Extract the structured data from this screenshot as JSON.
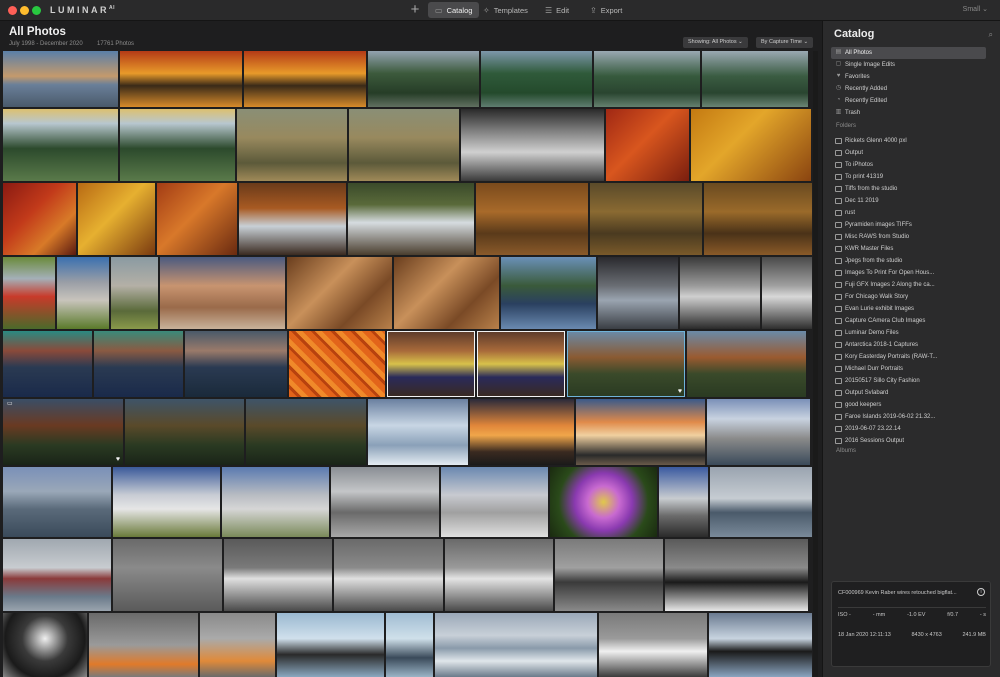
{
  "app": {
    "logo": "LUMINAR",
    "logo_super": "AI",
    "add_label": "+",
    "nav": [
      {
        "label": "Catalog",
        "icon": "folder-icon"
      },
      {
        "label": "Templates",
        "icon": "templates-icon"
      },
      {
        "label": "Edit",
        "icon": "sliders-icon"
      },
      {
        "label": "Export",
        "icon": "export-icon"
      }
    ],
    "size_label": "Small ⌄"
  },
  "main": {
    "title": "All Photos",
    "date_range": "July 1998 - December 2020",
    "photo_count": "17761 Photos",
    "showing_filter": "Showing: All Photos ⌄",
    "sort_label": "By Capture Time ⌄"
  },
  "sidebar": {
    "title": "Catalog",
    "items": [
      {
        "label": "All Photos",
        "icon": "photos-icon",
        "active": true
      },
      {
        "label": "Single Image Edits",
        "icon": "single-image-icon"
      },
      {
        "label": "Favorites",
        "icon": "heart-icon"
      },
      {
        "label": "Recently Added",
        "icon": "clock-icon"
      },
      {
        "label": "Recently Edited",
        "icon": "edited-icon"
      },
      {
        "label": "Trash",
        "icon": "trash-icon"
      }
    ],
    "folders_header": "Folders",
    "folders": [
      "Rickets Glenn 4000 pxl",
      "Output",
      "To iPhotos",
      "To print 41319",
      "Tiffs from the studio",
      "Dec 11 2019",
      "rust",
      "Pyramiden images TIFFs",
      "Misc RAWS from Studio",
      "KWR Master Files",
      "Jpegs from the studio",
      "Images To Print For Open Hous...",
      "Fuji GFX Images 2 Along the ca...",
      "For Chicago Walk Story",
      "Evan Lurie exhibit Images",
      "Capture CAmera Club Images",
      "Luminar Demo Files",
      "Antarctica 2018-1 Captures",
      "Kory Easterday Portraits (RAW-T...",
      "Michael Durr Portraits",
      "20150517 Sillo City Fashion",
      "Output Svlabard",
      "good keepers",
      "Faroe Islands 2019-06-02 21.32...",
      "2019-06-07 23.22.14",
      "2016 Sessions Output"
    ],
    "albums_header": "Albums",
    "info": {
      "filename": "CF000969 Kevin Raber wires retouched bigflat...",
      "info_glyph": "i",
      "iso": "ISO -",
      "focal": "- mm",
      "ev": "-1.0 EV",
      "aperture": "f/0.7",
      "shutter": "- s",
      "date": "18 Jan 2020 12:11:13",
      "dimensions": "8430 x 4763",
      "filesize": "241.9 MB"
    }
  },
  "grid": {
    "rows": [
      {
        "h": 56,
        "thumbs": [
          {
            "w": 115,
            "bg": "linear-gradient(180deg,#5a7fa8 0%,#c49a6c 45%,#6a7f99 60%,#4a5a6b 100%)"
          },
          {
            "w": 122,
            "bg": "linear-gradient(180deg,#b43a16 0%,#e89a2a 40%,#3a2a18 62%,#d88b2a 100%)"
          },
          {
            "w": 122,
            "bg": "linear-gradient(180deg,#b43a16 0%,#e89a2a 40%,#3a2a18 62%,#d88b2a 100%)"
          },
          {
            "w": 111,
            "bg": "linear-gradient(180deg,#93a2b0 0%,#3c5a3c 40%,#263d27 75%,#607060 100%)"
          },
          {
            "w": 111,
            "bg": "linear-gradient(180deg,#7d97ab 0%,#2f5a3a 40%,#244a2c 75%,#5f7d70 100%)"
          },
          {
            "w": 106,
            "bg": "linear-gradient(180deg,#9aa8b2 0%,#365a3d 45%,#2a4530 75%,#64806e 100%)"
          },
          {
            "w": 106,
            "bg": "linear-gradient(180deg,#9aa8b2 0%,#3a5c42 45%,#2a4530 75%,#6a8574 100%)"
          }
        ]
      },
      {
        "h": 72,
        "thumbs": [
          {
            "w": 115,
            "bg": "linear-gradient(180deg,#dcc070 0%,#b8c7cf 20%,#2c4a2c 55%,#5a7a4a 100%)"
          },
          {
            "w": 115,
            "bg": "linear-gradient(180deg,#dcc070 0%,#b8c7cf 20%,#2c4a2c 55%,#5a7a4a 100%)"
          },
          {
            "w": 110,
            "bg": "linear-gradient(180deg,#8a8f76 0%,#98895e 40%,#5c5a3a 75%,#a08a58 100%)"
          },
          {
            "w": 110,
            "bg": "linear-gradient(180deg,#8a8f76 0%,#98895e 40%,#5c5a3a 75%,#a08a58 100%)"
          },
          {
            "w": 143,
            "bg": "linear-gradient(180deg,#2a2a2a 0%,#8c8c8c 35%,#d0d0d0 60%,#3a3a3a 100%)"
          },
          {
            "w": 83,
            "bg": "linear-gradient(135deg,#a02814 0%,#d8561e 45%,#7a1e0e 100%)"
          },
          {
            "w": 120,
            "bg": "linear-gradient(135deg,#c47a12 0%,#e3a62a 40%,#8a4410 100%)"
          }
        ]
      },
      {
        "h": 72,
        "thumbs": [
          {
            "w": 73,
            "bg": "linear-gradient(135deg,#8a1a12 0%,#c23a1a 40%,#d87a28 70%,#5a1a10 100%)"
          },
          {
            "w": 77,
            "bg": "linear-gradient(135deg,#b86a14 0%,#e6b030 45%,#7a3a10 100%)"
          },
          {
            "w": 80,
            "bg": "linear-gradient(135deg,#a33c14 0%,#d8782a 45%,#6a2a10 100%)"
          },
          {
            "w": 107,
            "bg": "linear-gradient(180deg,#6a3a1a 0%,#a85a22 35%,#c8d0d6 60%,#3a2a20 100%)"
          },
          {
            "w": 126,
            "bg": "linear-gradient(180deg,#3a4a2a 0%,#5a6a3a 30%,#d6dce0 55%,#4a3e2e 100%)"
          },
          {
            "w": 112,
            "bg": "linear-gradient(180deg,#7a4a1c 0%,#a86a2a 40%,#5a3a1a 70%,#8a5a2a 100%)"
          },
          {
            "w": 112,
            "bg": "linear-gradient(180deg,#5a4a2a 0%,#8a6a32 40%,#4a3a20 70%,#7a5a2a 100%)"
          },
          {
            "w": 110,
            "bg": "linear-gradient(180deg,#6a4a20 0%,#9a6a2a 40%,#4a3218 70%,#8a5a28 100%)"
          }
        ]
      },
      {
        "h": 72,
        "thumbs": [
          {
            "w": 52,
            "bg": "linear-gradient(180deg,#6a8a3a 0%,#a4b0b8 30%,#c83a2a 55%,#4a6a2a 100%)"
          },
          {
            "w": 52,
            "bg": "linear-gradient(180deg,#3a70b0 0%,#9a9ea6 35%,#c8c4bc 60%,#5a7a2a 100%)"
          },
          {
            "w": 47,
            "bg": "linear-gradient(180deg,#8a9aa2 0%,#b4b0a6 40%,#5a6a3a 75%,#8a9a4a 100%)"
          },
          {
            "w": 125,
            "bg": "linear-gradient(180deg,#4a5a80 0%,#c89470 40%,#9a6a4a 70%,#c8b29a 100%)"
          },
          {
            "w": 105,
            "bg": "linear-gradient(135deg,#6a3e1e 0%,#c8905a 40%,#7a4a26 70%,#b8804a 100%)"
          },
          {
            "w": 105,
            "bg": "linear-gradient(135deg,#6a3e1e 0%,#c8905a 40%,#7a4a26 70%,#b8804a 100%)"
          },
          {
            "w": 95,
            "bg": "linear-gradient(180deg,#6a90b8 0%,#3a5a3a 40%,#2a4060 65%,#6a8ab0 100%)"
          },
          {
            "w": 80,
            "bg": "linear-gradient(180deg,#2a2a2e 0%,#6a6e74 40%,#9aa4b0 60%,#3a3e44 100%)"
          },
          {
            "w": 80,
            "bg": "linear-gradient(180deg,#3a3a3a 0%,#9a9a9a 40%,#cfcfcf 55%,#2a2a2a 100%)"
          },
          {
            "w": 55,
            "bg": "linear-gradient(180deg,#4a4a4a 0%,#a0a0a0 40%,#d8d8d8 55%,#2e2e2e 100%)"
          }
        ]
      },
      {
        "h": 66,
        "thumbs": [
          {
            "w": 89,
            "bg": "linear-gradient(180deg,#2a8a82 0%,#8a4a3a 30%,#2a3a52 55%,#1a2a4a 100%)"
          },
          {
            "w": 89,
            "bg": "linear-gradient(180deg,#3a8a7a 0%,#8a5a42 30%,#2a3a52 55%,#1a2a4a 100%)"
          },
          {
            "w": 102,
            "bg": "linear-gradient(180deg,#4a5a6a 0%,#9a7a6a 30%,#2a3a52 55%,#1a2a3a 100%)"
          },
          {
            "w": 96,
            "bg": "repeating-linear-gradient(45deg,#e2641a 0 6px,#b8420e 6px 9px,#f08a2a 9px 14px)"
          },
          {
            "w": 88,
            "sel": "white",
            "bg": "linear-gradient(180deg,#5a3a2a 0%,#a86a3a 30%,#d8c24a 50%,#2a2a5a 70%,#3a2a20 100%)"
          },
          {
            "w": 88,
            "sel": "white",
            "bg": "linear-gradient(180deg,#5a3a2a 0%,#a86a3a 30%,#d8c24a 50%,#2a2a5a 70%,#3a2a20 100%)"
          },
          {
            "w": 118,
            "sel": "blue",
            "heart": true,
            "bg": "linear-gradient(180deg,#6a8aa8 0%,#8a5a32 40%,#3a4a2a 65%,#2a3a22 100%)"
          },
          {
            "w": 119,
            "bg": "linear-gradient(180deg,#6a8aa8 0%,#9a5a30 40%,#3a4a2a 65%,#2a3a22 100%)"
          }
        ]
      },
      {
        "h": 66,
        "thumbs": [
          {
            "w": 120,
            "heart": true,
            "warn": true,
            "bg": "linear-gradient(180deg,#3a4e66 0%,#6a3a22 40%,#2a3a22 70%,#1a2418 100%)"
          },
          {
            "w": 119,
            "bg": "linear-gradient(180deg,#3e5468 0%,#5a4a2a 40%,#2a3a22 70%,#1a2418 100%)"
          },
          {
            "w": 120,
            "bg": "linear-gradient(180deg,#3e5468 0%,#5a4a2a 40%,#2a3a22 70%,#1a2418 100%)"
          },
          {
            "w": 100,
            "bg": "linear-gradient(180deg,#6a80a0 0%,#c8d6e4 40%,#8aa0b8 70%,#e4ecf2 100%)"
          },
          {
            "w": 104,
            "bg": "linear-gradient(180deg,#2a2a3a 0%,#e0863a 40%,#f0a64a 55%,#3a2a20 80%,#1a1a1a 100%)"
          },
          {
            "w": 129,
            "bg": "linear-gradient(180deg,#3a5a8a 0%,#e08a4a 35%,#f0d0a0 55%,#2a2a2a 85%,#6a5a4a 100%)"
          },
          {
            "w": 103,
            "bg": "linear-gradient(180deg,#7a90b8 0%,#c8d2e0 30%,#8a8a8a 60%,#3a4a5a 100%)"
          }
        ]
      },
      {
        "h": 70,
        "thumbs": [
          {
            "w": 108,
            "bg": "linear-gradient(180deg,#7a90b8 0%,#9aa8b8 35%,#5a6a7a 60%,#3a4a5a 100%)"
          },
          {
            "w": 107,
            "bg": "linear-gradient(180deg,#3a5a9a 0%,#c8ccd4 40%,#e6e6e6 60%,#6a7a3a 100%)"
          },
          {
            "w": 107,
            "bg": "linear-gradient(180deg,#5a7ab0 0%,#b8bcc2 40%,#d6d6d6 60%,#7a8a5a 100%)"
          },
          {
            "w": 108,
            "bg": "linear-gradient(180deg,#8a8e94 0%,#c4c6c8 35%,#6a6a6a 65%,#a8a8a8 100%)"
          },
          {
            "w": 107,
            "bg": "linear-gradient(180deg,#6a88b0 0%,#c8cad0 40%,#a0a0a0 65%,#e0e0e0 100%)"
          },
          {
            "w": 107,
            "bg": "radial-gradient(circle at 50% 50%,#e0c84a 0%,#c86ad0 25%,#8a3ab0 45%,#2a4a1a 70%,#1a2a10 100%)"
          },
          {
            "w": 49,
            "bg": "linear-gradient(180deg,#3a5aa0 0%,#c8ccd0 45%,#6a6a6a 70%,#2a2a2a 100%)"
          },
          {
            "w": 108,
            "bg": "linear-gradient(180deg,#9aa4b0 0%,#c6ccd2 45%,#4a5a6a 65%,#7a8a9a 100%)"
          }
        ]
      },
      {
        "h": 72,
        "thumbs": [
          {
            "w": 108,
            "bg": "linear-gradient(180deg,#a0a8b0 0%,#c8ccd0 40%,#8a3a3a 55%,#6a7a8a 80%,#9aa4ae 100%)"
          },
          {
            "w": 109,
            "bg": "linear-gradient(180deg,#6a6a6a 0%,#8a8a8a 40%,#5a5a5a 100%)"
          },
          {
            "w": 108,
            "bg": "linear-gradient(180deg,#5a5a5a 0%,#7a7a7a 40%,#e0e0e0 55%,#4a4a4a 100%)"
          },
          {
            "w": 109,
            "bg": "linear-gradient(180deg,#6a6a6a 0%,#8a8a8a 40%,#e0e0e0 55%,#4a4a4a 100%)"
          },
          {
            "w": 108,
            "bg": "linear-gradient(180deg,#6a6a6a 0%,#9a9a9a 40%,#e4e4e4 55%,#4a4a4a 100%)"
          },
          {
            "w": 108,
            "bg": "linear-gradient(180deg,#7a7a7a 0%,#a0a0a0 40%,#3a3a3a 60%,#8a8a8a 100%)"
          },
          {
            "w": 143,
            "bg": "linear-gradient(180deg,#5a5a5a 0%,#8a8a8a 40%,#1a1a1a 60%,#e8e8e8 100%)"
          }
        ]
      },
      {
        "h": 64,
        "thumbs": [
          {
            "w": 84,
            "bg": "radial-gradient(circle at 50% 40%,#f0f0f0 0%,#3a3a3a 40%,#1a1a1a 70%,#8a8a8a 100%)"
          },
          {
            "w": 109,
            "bg": "linear-gradient(180deg,#6a6a6a 0%,#9a9a9a 50%,#e07a2a 80%,#7a7a7a 100%)"
          },
          {
            "w": 75,
            "bg": "linear-gradient(180deg,#8a8a8a 0%,#aaaaaa 40%,#e08a3a 75%,#6a6a6a 100%)"
          },
          {
            "w": 107,
            "bg": "linear-gradient(180deg,#9ab8d0 0%,#d0e0ec 40%,#2a2a2a 65%,#8aa8c0 100%)"
          },
          {
            "w": 47,
            "bg": "linear-gradient(180deg,#a0bcd2 0%,#cfe0ea 40%,#3a4a5a 70%,#9ab4c6 100%)"
          },
          {
            "w": 162,
            "bg": "linear-gradient(180deg,#9aa8b8 0%,#c8d0d8 35%,#8a9aaa 55%,#e0e6ea 75%,#6a7a8a 100%)"
          },
          {
            "w": 108,
            "bg": "linear-gradient(180deg,#7a7a7a 0%,#9a9a9a 40%,#f0f0f0 60%,#3a3a3a 100%)"
          },
          {
            "w": 107,
            "bg": "linear-gradient(180deg,#6a7a90 0%,#c8d4e0 40%,#1a1a1a 60%,#8aa4c0 100%)"
          }
        ]
      }
    ]
  }
}
